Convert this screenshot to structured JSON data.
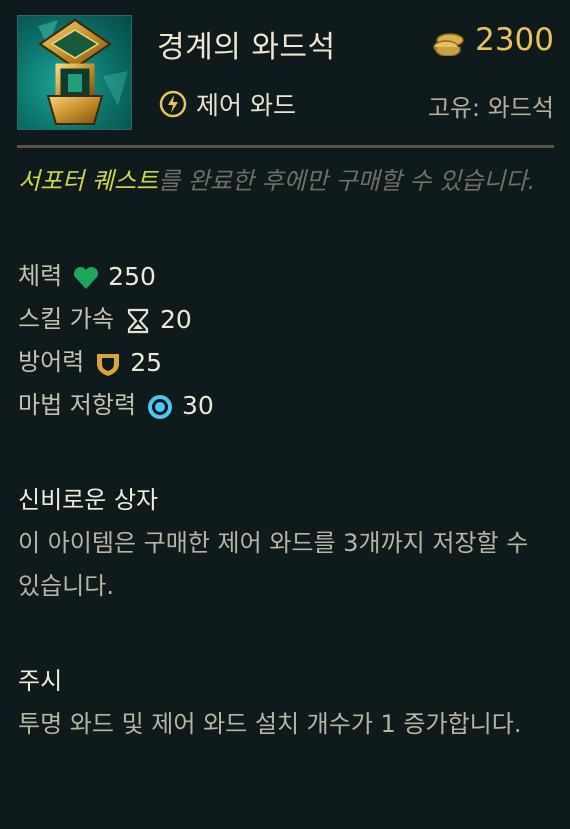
{
  "item": {
    "name": "경계의 와드석",
    "cost": "2300",
    "type": "제어 와드",
    "unique": "고유: 와드석",
    "icon": "vigilant-wardstone-icon"
  },
  "requirement": {
    "highlight": "서포터 퀘스트",
    "rest": "를 완료한 후에만 구매할 수 있습니다."
  },
  "stats": [
    {
      "label": "체력",
      "icon": "heart-icon",
      "value": "250",
      "color": "#1fa55a"
    },
    {
      "label": "스킬 가속",
      "icon": "hourglass-icon",
      "value": "20",
      "color": "#e8e2d0"
    },
    {
      "label": "방어력",
      "icon": "shield-icon",
      "value": "25",
      "color": "#d9a53a"
    },
    {
      "label": "마법 저항력",
      "icon": "magic-resist-icon",
      "value": "30",
      "color": "#4ec6f2"
    }
  ],
  "passives": [
    {
      "title": "신비로운 상자",
      "desc": "이 아이템은 구매한 제어 와드를 3개까지 저장할 수 있습니다."
    },
    {
      "title": "주시",
      "desc": "투명 와드 및 제어 와드 설치 개수가 1 증가합니다."
    }
  ],
  "colors": {
    "background": "#0e1a1b",
    "gold": "#e8c25a",
    "quest": "#cdd64b",
    "divider": "#5b5443"
  }
}
